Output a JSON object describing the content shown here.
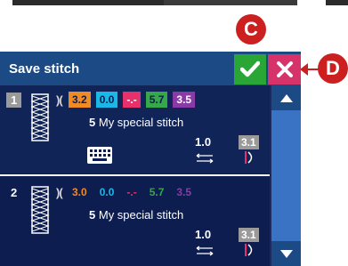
{
  "callouts": {
    "c": "C",
    "d": "D"
  },
  "header": {
    "title": "Save stitch"
  },
  "icons": {
    "confirm": "checkmark-icon",
    "cancel": "close-icon",
    "mirror": "mirror-icon",
    "keyboard": "keyboard-icon",
    "stitch_length": "stitch-length-icon",
    "stitch_width": "stitch-width-icon",
    "scroll_up": "triangle-up-icon",
    "scroll_down": "triangle-down-icon"
  },
  "colors": {
    "header_bg": "#1c4a84",
    "confirm_green": "#2aa637",
    "cancel_pink": "#d6336b",
    "callout_red": "#cc2020",
    "orange": "#f08a24",
    "cyan": "#19b8e6",
    "pink": "#e8306a",
    "green": "#35a84a",
    "purple": "#8a3aa6"
  },
  "stitches": [
    {
      "index": "1",
      "selected": true,
      "mirror": ")(",
      "values": [
        "3.2",
        "0.0",
        "-.-",
        "5.7",
        "3.5"
      ],
      "number": "5",
      "name": "My special stitch",
      "length": "1.0",
      "width": "3.1",
      "has_keyboard": true
    },
    {
      "index": "2",
      "selected": false,
      "mirror": ")(",
      "values": [
        "3.0",
        "0.0",
        "-.-",
        "5.7",
        "3.5"
      ],
      "number": "5",
      "name": "My special stitch",
      "length": "1.0",
      "width": "3.1",
      "has_keyboard": false
    }
  ]
}
